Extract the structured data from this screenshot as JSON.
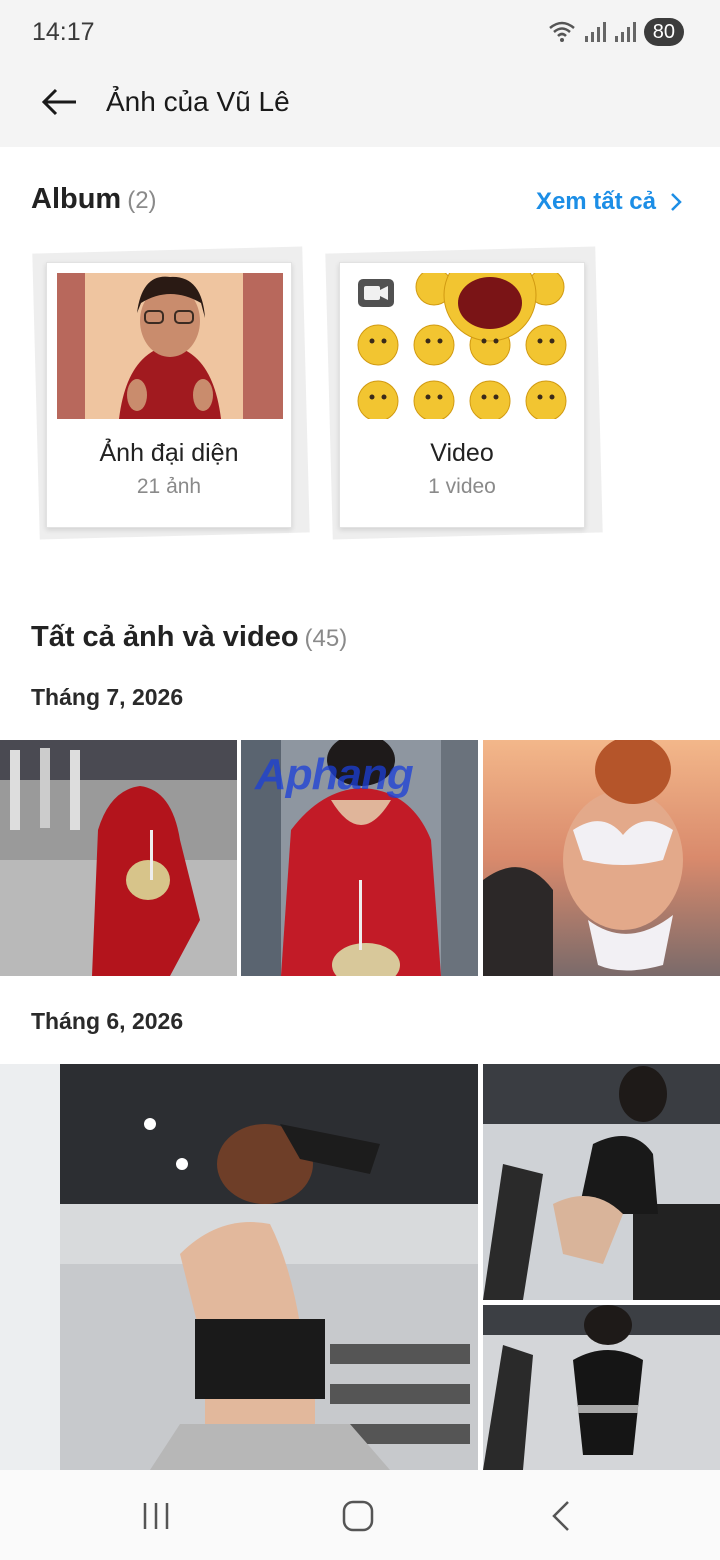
{
  "status": {
    "time": "14:17",
    "battery": "80"
  },
  "header": {
    "title": "Ảnh của Vũ Lê"
  },
  "albums": {
    "heading": "Album",
    "count": "(2)",
    "see_all": "Xem tất cả",
    "items": [
      {
        "name": "Ảnh đại diện",
        "sub": "21 ảnh"
      },
      {
        "name": "Video",
        "sub": "1 video"
      }
    ]
  },
  "all": {
    "heading": "Tất cả ảnh và video",
    "count": "(45)",
    "watermark": "Aphang",
    "months": [
      {
        "label": "Tháng 7, 2026"
      },
      {
        "label": "Tháng 6, 2026"
      }
    ]
  },
  "colors": {
    "accent": "#1c8ee6",
    "header_bg": "#f4f4f4"
  }
}
